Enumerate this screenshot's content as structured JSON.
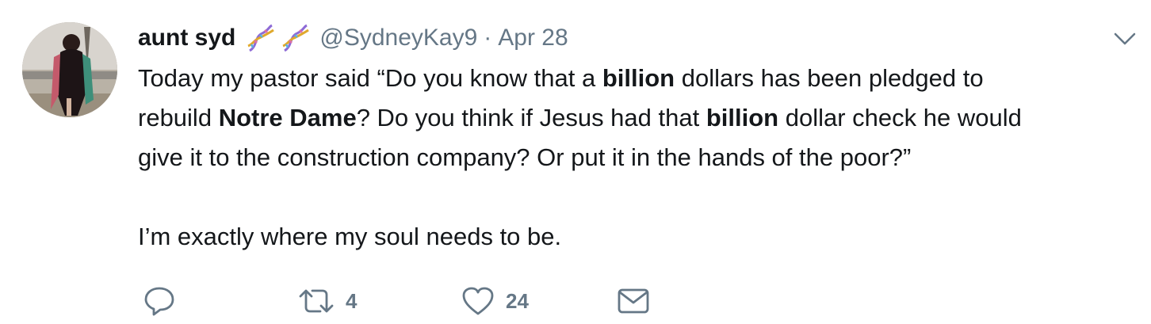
{
  "tweet": {
    "display_name": "aunt syd",
    "name_emoji": [
      "dna-icon",
      "dna-icon"
    ],
    "handle": "@SydneyKay9",
    "separator": "·",
    "date": "Apr 28",
    "body": {
      "line1_a": "Today my pastor said “Do you know that a ",
      "line1_bold": "billion",
      "line1_b": " dollars has been pledged to",
      "line2_a": "rebuild ",
      "line2_bold": "Notre Dame",
      "line2_b": "? Do you think if Jesus had that ",
      "line2_bold2": "billion",
      "line2_c": " dollar check he would",
      "line3": "give it to the construction company? Or put it in the hands of the poor?”",
      "line4": "I’m exactly where my soul needs to be."
    },
    "actions": {
      "reply_count": "",
      "retweet_count": "4",
      "like_count": "24"
    }
  },
  "colors": {
    "text": "#14171a",
    "secondary": "#657786"
  }
}
